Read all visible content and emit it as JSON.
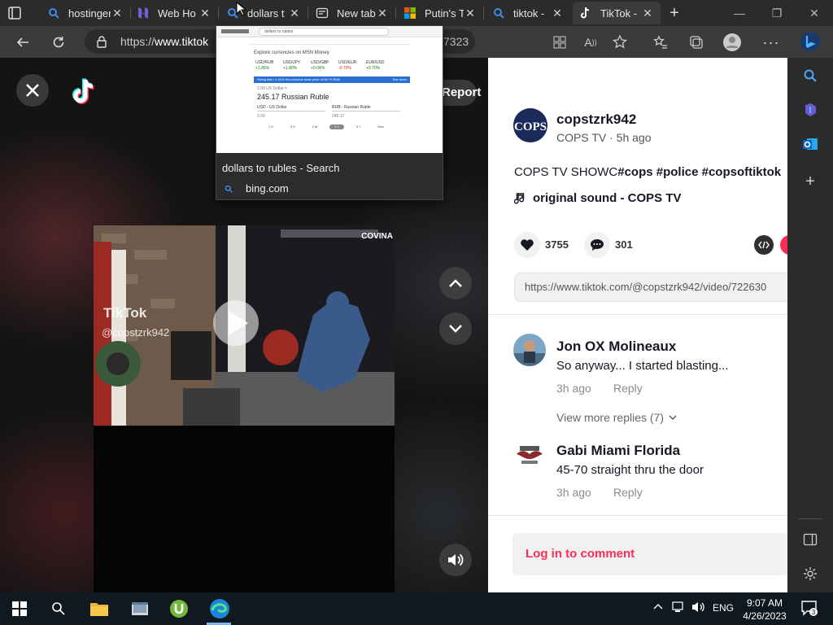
{
  "browser": {
    "tabs": [
      {
        "title": "hostinger",
        "favicon": "search-icon"
      },
      {
        "title": "Web Ho",
        "favicon": "hostinger-icon"
      },
      {
        "title": "dollars t",
        "favicon": "search-icon"
      },
      {
        "title": "New tab",
        "favicon": "newtab-icon"
      },
      {
        "title": "Putin's T",
        "favicon": "microsoft-icon"
      },
      {
        "title": "tiktok -",
        "favicon": "search-icon"
      },
      {
        "title": "TikTok -",
        "favicon": "tiktok-icon"
      }
    ],
    "url_prefix": "https://",
    "url_host": "www.tiktok",
    "url_tail": "7323"
  },
  "tooltip": {
    "title": "dollars to rubles - Search",
    "domain": "bing.com",
    "thumb": {
      "search_query": "dollars to rubles",
      "heading": "Explore currencies on MSN Money",
      "quotes": [
        {
          "pair": "USD/RUB",
          "change": "+1.85%"
        },
        {
          "pair": "USD/JPY",
          "change": "+1.80%"
        },
        {
          "pair": "USD/GBP",
          "change": "+0.04%"
        },
        {
          "pair": "USD/EUR",
          "change": "-0.70%"
        },
        {
          "pair": "EUR/USD",
          "change": "+0.70%"
        }
      ],
      "banner": "Rising fast • 1.41% the previous close price of 80.79 RUB",
      "banner_link": "See more",
      "from_line": "2.99 US Dollar =",
      "result": "245.17 Russian Ruble",
      "from_currency": "USD - US Dollar",
      "to_currency": "RUB - Russian Ruble",
      "from_value": "2.99",
      "to_value": "245.17",
      "ranges": [
        "1 D",
        "5 D",
        "1 M",
        "1 Y",
        "5 Y",
        "Max"
      ]
    }
  },
  "video": {
    "watermark_brand": "TikTok",
    "watermark_user": "@copstzrk942",
    "cam_label": "COVINA",
    "report_label": "Report"
  },
  "post": {
    "username": "copstzrk942",
    "display_name": "COPS TV",
    "time": "5h ago",
    "description": "COPS TV SHOWC",
    "hashtags": "#cops #police #copsoftiktok",
    "sound": "original sound - COPS TV",
    "likes": "3755",
    "comments": "301",
    "link": "https://www.tiktok.com/@copstzrk942/video/722630"
  },
  "comments": [
    {
      "name": "Jon OX Molineaux",
      "text": "So anyway... I started blasting...",
      "time": "3h ago",
      "reply": "Reply",
      "more": "View more replies (7)"
    },
    {
      "name": "Gabi Miami Florida",
      "text": "45-70 straight thru the door",
      "time": "3h ago",
      "reply": "Reply"
    }
  ],
  "login_label": "Log in to comment",
  "taskbar": {
    "lang": "ENG",
    "time": "9:07 AM",
    "date": "4/26/2023",
    "notifications": "3"
  },
  "colors": {
    "tiktok_red": "#fe2c55",
    "tiktok_cyan": "#25f4ee",
    "edge_bg": "#2b2b2b"
  }
}
